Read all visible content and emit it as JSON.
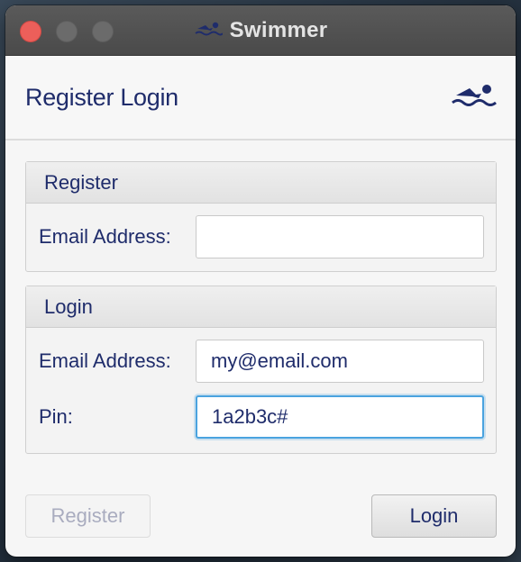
{
  "window": {
    "title": "Swimmer",
    "title_icon": "swimmer-icon"
  },
  "header": {
    "title": "Register Login",
    "icon": "swimmer-icon"
  },
  "register_panel": {
    "heading": "Register",
    "email_label": "Email Address:",
    "email_value": ""
  },
  "login_panel": {
    "heading": "Login",
    "email_label": "Email Address:",
    "email_value": "my@email.com",
    "pin_label": "Pin:",
    "pin_value": "1a2b3c#"
  },
  "buttons": {
    "register_label": "Register",
    "register_enabled": false,
    "login_label": "Login"
  },
  "colors": {
    "text": "#1f2c6b",
    "focus": "#4aa3df",
    "close": "#ec5f5a"
  }
}
